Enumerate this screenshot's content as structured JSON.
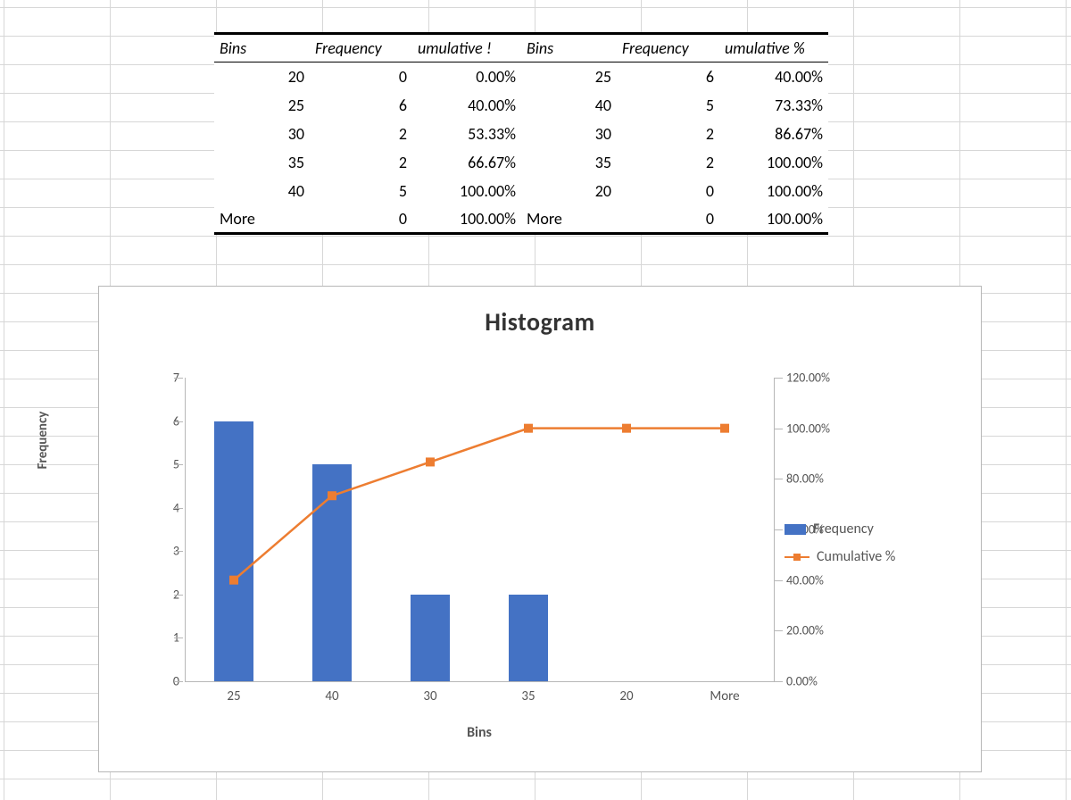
{
  "table": {
    "headers_left": {
      "bins": "Bins",
      "freq": "Frequency",
      "cum": "umulative !"
    },
    "headers_right": {
      "bins": "Bins",
      "freq": "Frequency",
      "cum": "umulative %"
    },
    "rows_left": [
      {
        "bin": "20",
        "freq": "0",
        "cum": "0.00%"
      },
      {
        "bin": "25",
        "freq": "6",
        "cum": "40.00%"
      },
      {
        "bin": "30",
        "freq": "2",
        "cum": "53.33%"
      },
      {
        "bin": "35",
        "freq": "2",
        "cum": "66.67%"
      },
      {
        "bin": "40",
        "freq": "5",
        "cum": "100.00%"
      },
      {
        "bin": "More",
        "freq": "0",
        "cum": "100.00%"
      }
    ],
    "rows_right": [
      {
        "bin": "25",
        "freq": "6",
        "cum": "40.00%"
      },
      {
        "bin": "40",
        "freq": "5",
        "cum": "73.33%"
      },
      {
        "bin": "30",
        "freq": "2",
        "cum": "86.67%"
      },
      {
        "bin": "35",
        "freq": "2",
        "cum": "100.00%"
      },
      {
        "bin": "20",
        "freq": "0",
        "cum": "100.00%"
      },
      {
        "bin": "More",
        "freq": "0",
        "cum": "100.00%"
      }
    ]
  },
  "chart": {
    "title": "Histogram",
    "xlabel": "Bins",
    "ylabel": "Frequency",
    "y1_ticks": [
      "0",
      "1",
      "2",
      "3",
      "4",
      "5",
      "6",
      "7"
    ],
    "y2_ticks": [
      "0.00%",
      "20.00%",
      "40.00%",
      "60.00%",
      "80.00%",
      "100.00%",
      "120.00%"
    ],
    "legend": {
      "bar": "Frequency",
      "line": "Cumulative %"
    }
  },
  "chart_data": {
    "type": "bar",
    "title": "Histogram",
    "xlabel": "Bins",
    "ylabel": "Frequency",
    "categories": [
      "25",
      "40",
      "30",
      "35",
      "20",
      "More"
    ],
    "y1_range": [
      0,
      7
    ],
    "y2_range": [
      0,
      120
    ],
    "series": [
      {
        "name": "Frequency",
        "axis": "y1",
        "kind": "bar",
        "values": [
          6,
          5,
          2,
          2,
          0,
          0
        ]
      },
      {
        "name": "Cumulative %",
        "axis": "y2",
        "kind": "line",
        "values": [
          40.0,
          73.33,
          86.67,
          100.0,
          100.0,
          100.0
        ]
      }
    ]
  }
}
